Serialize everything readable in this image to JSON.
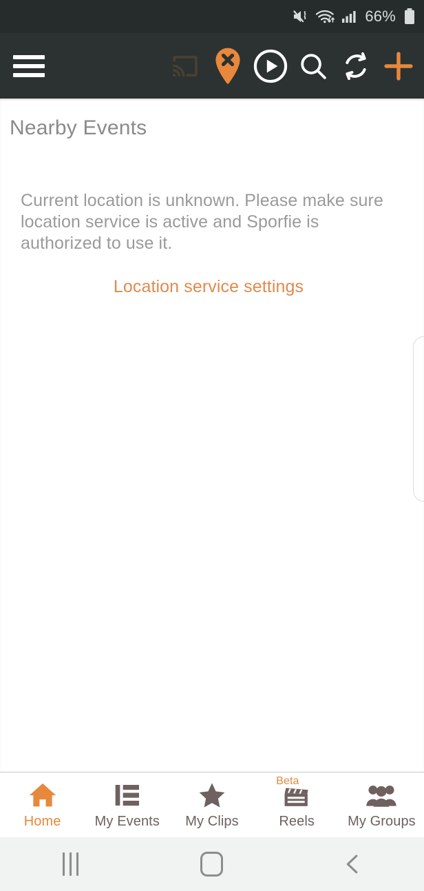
{
  "status_bar": {
    "battery_percent": "66%",
    "icons": [
      "mute-vibrate-icon",
      "wifi-icon",
      "cellular-signal-icon",
      "battery-icon"
    ]
  },
  "toolbar": {
    "menu_icon": "hamburger-menu-icon",
    "actions": [
      {
        "name": "cast-icon",
        "label": "Cast",
        "state": "disabled"
      },
      {
        "name": "location-pin-off-icon",
        "label": "Location unavailable",
        "state": "active"
      },
      {
        "name": "play-icon",
        "label": "Play"
      },
      {
        "name": "search-icon",
        "label": "Search"
      },
      {
        "name": "refresh-icon",
        "label": "Refresh"
      },
      {
        "name": "plus-icon",
        "label": "Add"
      }
    ]
  },
  "main": {
    "page_title": "Nearby Events",
    "message": "Current location is unknown. Please make sure location service is active and Sporfie is authorized to use it.",
    "link_label": "Location service settings"
  },
  "tab_bar": {
    "items": [
      {
        "label": "Home",
        "icon": "home-icon",
        "active": true
      },
      {
        "label": "My Events",
        "icon": "list-icon",
        "active": false
      },
      {
        "label": "My Clips",
        "icon": "star-icon",
        "active": false
      },
      {
        "label": "Reels",
        "icon": "clapperboard-icon",
        "active": false,
        "badge": "Beta"
      },
      {
        "label": "My Groups",
        "icon": "people-icon",
        "active": false
      }
    ]
  },
  "nav_bar": {
    "recents_label": "Recents",
    "home_label": "Home",
    "back_label": "Back"
  },
  "colors": {
    "accent": "#e8883c",
    "toolbar_bg": "#2b3231",
    "status_bg": "#262c2c",
    "text_gray": "#9a9a9a",
    "tab_gray": "#6e6160"
  }
}
